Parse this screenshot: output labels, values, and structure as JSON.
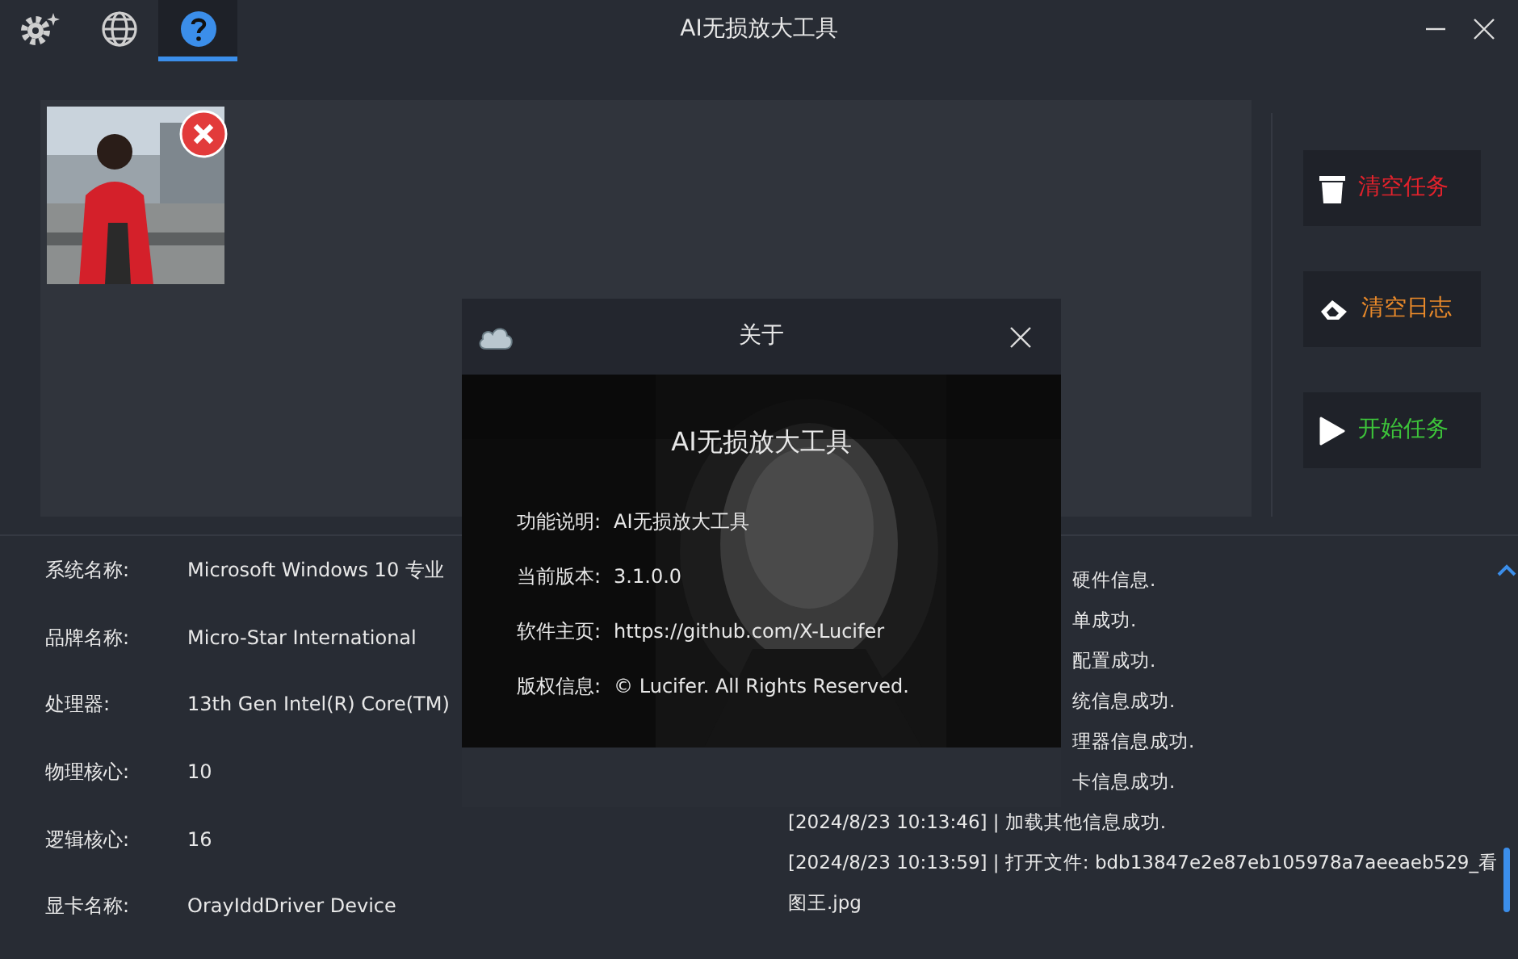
{
  "window": {
    "title": "AI无损放大工具"
  },
  "toolbar": [
    {
      "kind": "settings",
      "selected": false
    },
    {
      "kind": "language",
      "selected": false
    },
    {
      "kind": "help",
      "selected": true
    }
  ],
  "actions": [
    {
      "label": "清空任务",
      "kind": "trash",
      "color": "#e3222c"
    },
    {
      "label": "清空日志",
      "kind": "eraser",
      "color": "#e8892a"
    },
    {
      "label": "开始任务",
      "kind": "play",
      "color": "#3dc43a"
    }
  ],
  "system_info": [
    {
      "label": "系统名称:",
      "value": "Microsoft Windows 10 专业"
    },
    {
      "label": "品牌名称:",
      "value": "Micro-Star International"
    },
    {
      "label": "处理器:",
      "value": "13th Gen Intel(R) Core(TM)"
    },
    {
      "label": "物理核心:",
      "value": "10"
    },
    {
      "label": "逻辑核心:",
      "value": "16"
    },
    {
      "label": "显卡名称:",
      "value": "OrayIddDriver Device"
    }
  ],
  "log": [
    {
      "text": "硬件信息.",
      "kind": "partial"
    },
    {
      "text": "单成功.",
      "kind": "partial"
    },
    {
      "text": "配置成功.",
      "kind": "partial"
    },
    {
      "text": "统信息成功.",
      "kind": "partial"
    },
    {
      "text": "理器信息成功.",
      "kind": "partial"
    },
    {
      "text": "卡信息成功.",
      "kind": "partial"
    },
    {
      "text": "[2024/8/23 10:13:46] | 加载其他信息成功.",
      "kind": "full"
    },
    {
      "text": "[2024/8/23 10:13:59] | 打开文件: bdb13847e2e87eb105978a7aeeaeb529_看图王.jpg",
      "kind": "full"
    }
  ],
  "dialog": {
    "title": "关于",
    "heading": "AI无损放大工具",
    "rows": [
      {
        "label": "功能说明:",
        "value": "AI无损放大工具"
      },
      {
        "label": "当前版本:",
        "value": "3.1.0.0"
      },
      {
        "label": "软件主页:",
        "value": "https://github.com/X-Lucifer"
      },
      {
        "label": "版权信息:",
        "value": "© Lucifer. All Rights Reserved."
      }
    ]
  }
}
